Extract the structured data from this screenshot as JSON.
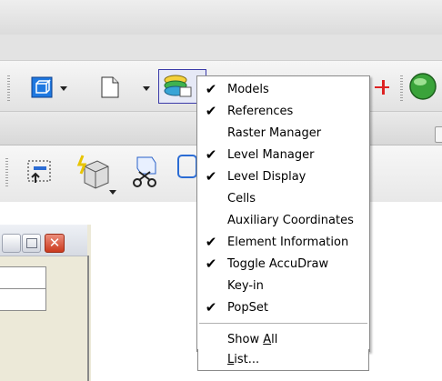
{
  "colors": {
    "menu_bg": "#ffffff",
    "menu_border": "#8a8a8a",
    "toolbar_bg": "#e6e6e6",
    "close_button": "#cb3a1e"
  },
  "menu": {
    "items": [
      {
        "label": "Models",
        "checked": true,
        "check": "✔"
      },
      {
        "label": "References",
        "checked": true,
        "check": "✔"
      },
      {
        "label": "Raster Manager",
        "checked": false,
        "check": ""
      },
      {
        "label": "Level Manager",
        "checked": true,
        "check": "✔"
      },
      {
        "label": "Level Display",
        "checked": true,
        "check": "✔"
      },
      {
        "label": "Cells",
        "checked": false,
        "check": ""
      },
      {
        "label": "Auxiliary Coordinates",
        "checked": false,
        "check": ""
      },
      {
        "label": "Element Information",
        "checked": true,
        "check": "✔"
      },
      {
        "label": "Toggle AccuDraw",
        "checked": true,
        "check": "✔"
      },
      {
        "label": "Key-in",
        "checked": false,
        "check": ""
      },
      {
        "label": "PopSet",
        "checked": true,
        "check": "✔"
      }
    ],
    "show_all": {
      "prefix": "Show ",
      "accel": "A",
      "suffix": "ll"
    },
    "list": {
      "prefix": "",
      "accel": "L",
      "suffix": "ist..."
    }
  },
  "window": {
    "close_glyph": "✕"
  },
  "icons": [
    "view-cube-icon",
    "new-file-icon",
    "layers-icon",
    "globe-icon",
    "place-icon",
    "lightning-cube-icon",
    "cut-icon"
  ]
}
